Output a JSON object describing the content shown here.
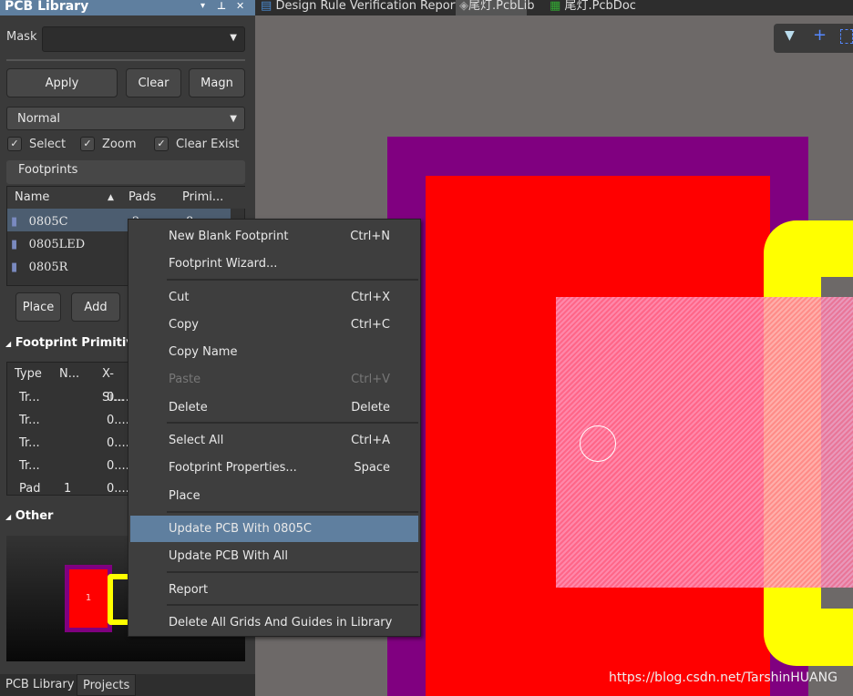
{
  "panel": {
    "title": "PCB Library",
    "mask_label": "Mask",
    "mask_value": "",
    "apply": "Apply",
    "clear": "Clear",
    "magnify": "Magn",
    "mode": "Normal",
    "checks": [
      {
        "label": "Select",
        "checked": true
      },
      {
        "label": "Zoom",
        "checked": true
      },
      {
        "label": "Clear Exist",
        "checked": true
      }
    ],
    "footprints_header": "Footprints",
    "fp_columns": [
      "Name",
      "Pads",
      "Primi..."
    ],
    "footprints": [
      {
        "name": "0805C",
        "pads": "2",
        "prims": "8"
      },
      {
        "name": "0805LED",
        "pads": "",
        "prims": ""
      },
      {
        "name": "0805R",
        "pads": "",
        "prims": ""
      }
    ],
    "place": "Place",
    "add": "Add",
    "primitives_header": "Footprint Primitives",
    "prim_columns": [
      "Type",
      "N...",
      "X-Si..."
    ],
    "primitives": [
      {
        "type": "Tr...",
        "n": "",
        "x": "0...."
      },
      {
        "type": "Tr...",
        "n": "",
        "x": "0...."
      },
      {
        "type": "Tr...",
        "n": "",
        "x": "0...."
      },
      {
        "type": "Tr...",
        "n": "",
        "x": "0...."
      },
      {
        "type": "Pad",
        "n": "1",
        "x": "0...."
      }
    ],
    "other_header": "Other",
    "preview_pad": "1",
    "bottom_tabs": [
      "PCB Library",
      "Projects"
    ]
  },
  "doc_tabs": [
    "Design Rule Verification Report",
    "尾灯.PcbLib",
    "尾灯.PcbDoc"
  ],
  "menu": [
    {
      "label": "New Blank Footprint",
      "shortcut": "Ctrl+N"
    },
    {
      "label": "Footprint Wizard...",
      "shortcut": ""
    },
    {
      "label": "Cut",
      "shortcut": "Ctrl+X"
    },
    {
      "label": "Copy",
      "shortcut": "Ctrl+C"
    },
    {
      "label": "Copy Name",
      "shortcut": ""
    },
    {
      "label": "Paste",
      "shortcut": "Ctrl+V",
      "disabled": true
    },
    {
      "label": "Delete",
      "shortcut": "Delete"
    },
    {
      "label": "Select All",
      "shortcut": "Ctrl+A"
    },
    {
      "label": "Footprint Properties...",
      "shortcut": "Space"
    },
    {
      "label": "Place",
      "shortcut": ""
    },
    {
      "label": "Update PCB With 0805C",
      "shortcut": "",
      "highlighted": true
    },
    {
      "label": "Update PCB With All",
      "shortcut": ""
    },
    {
      "label": "Report",
      "shortcut": ""
    },
    {
      "label": "Delete All Grids And Guides in Library",
      "shortcut": ""
    }
  ],
  "watermark": "https://blog.csdn.net/TarshinHUANG",
  "colors": {
    "accent": "#5f7f9f",
    "overlay": "#800080",
    "top_layer": "#ff0000",
    "silkscreen": "#ffff00",
    "paste": "#ff7fa0"
  }
}
